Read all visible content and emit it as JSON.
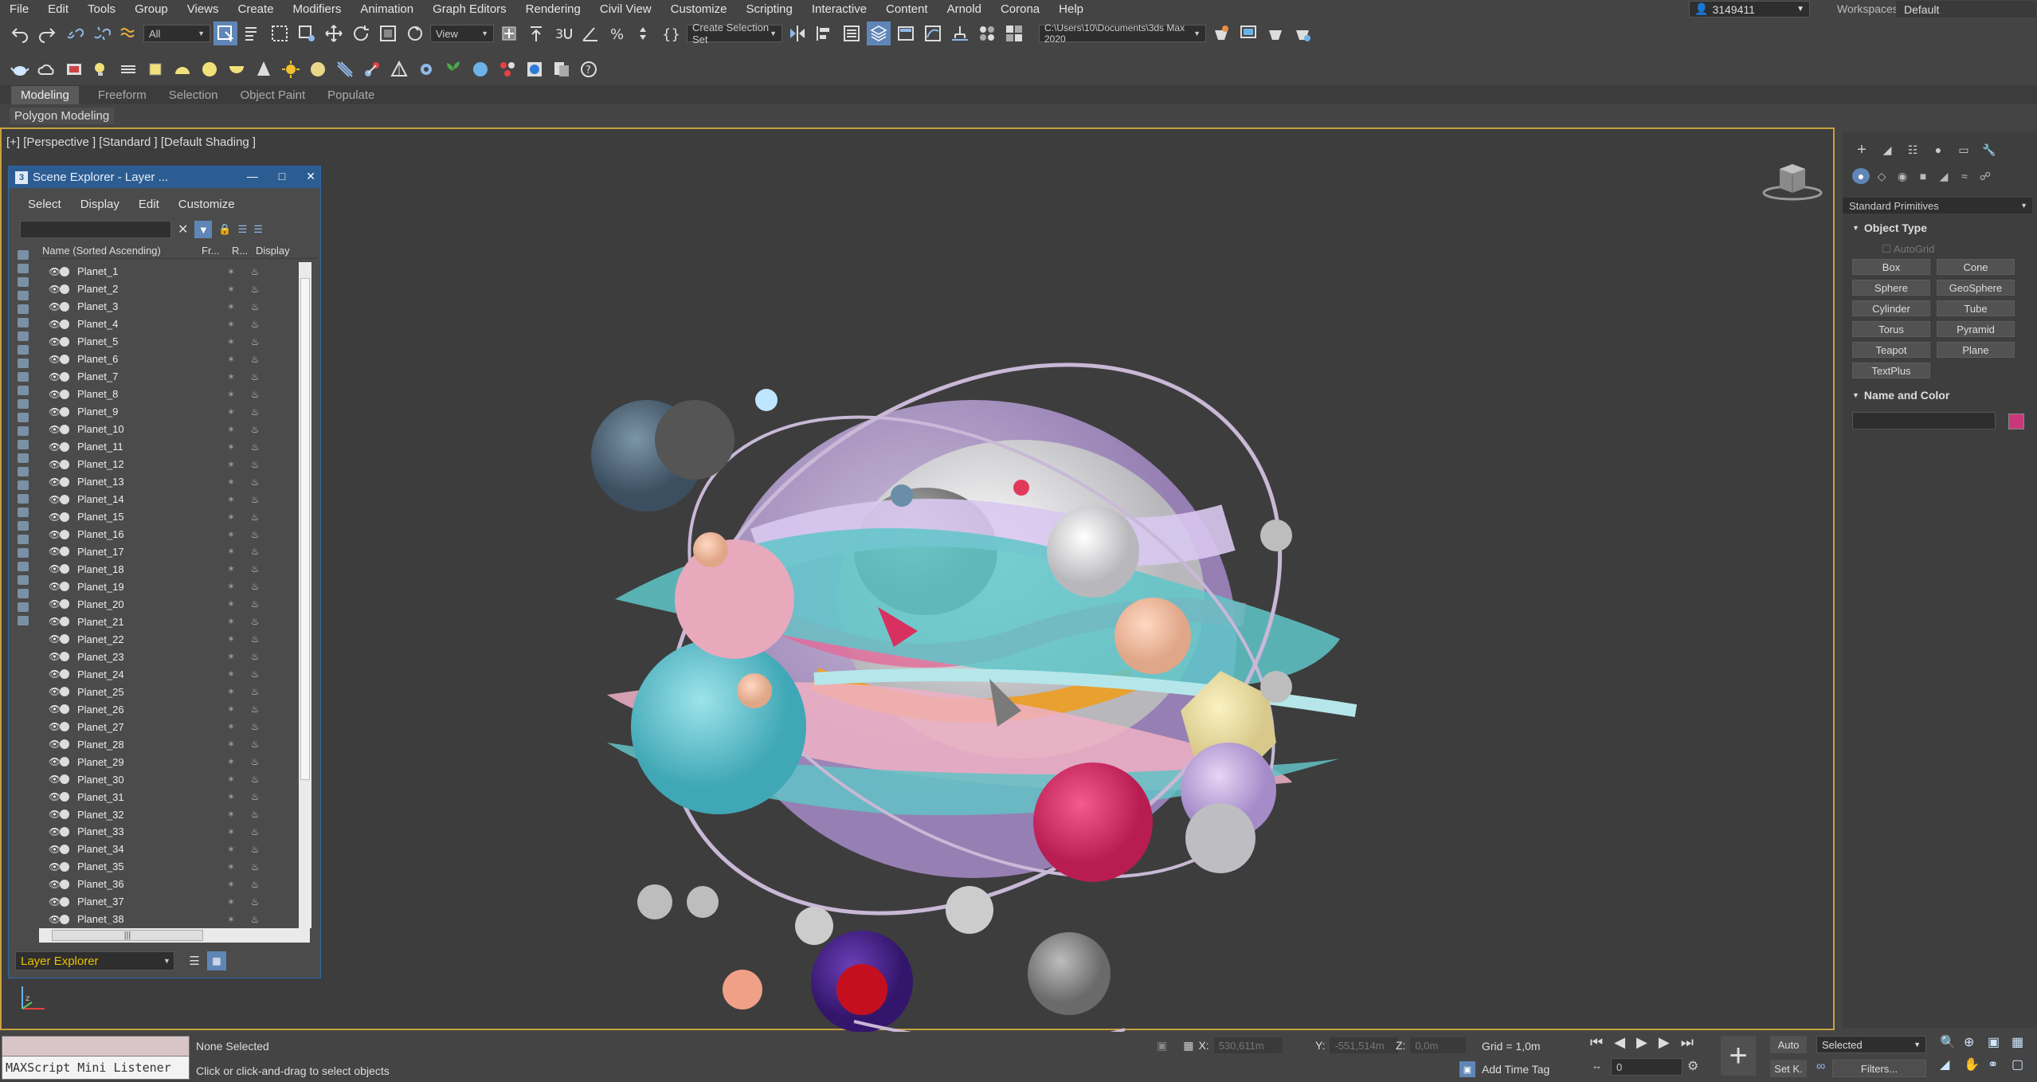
{
  "menu": [
    "File",
    "Edit",
    "Tools",
    "Group",
    "Views",
    "Create",
    "Modifiers",
    "Animation",
    "Graph Editors",
    "Rendering",
    "Civil View",
    "Customize",
    "Scripting",
    "Interactive",
    "Content",
    "Arnold",
    "Corona",
    "Help"
  ],
  "user": "3149411",
  "workspace": {
    "label": "Workspaces:",
    "value": "Default"
  },
  "toolbar": {
    "filter_value": "All",
    "coord_value": "View",
    "selection_set": "Create Selection Set",
    "project_path": "C:\\Users\\10\\Documents\\3ds Max 2020"
  },
  "ribbon": {
    "tabs": [
      "Modeling",
      "Freeform",
      "Selection",
      "Object Paint",
      "Populate"
    ],
    "active": "Modeling",
    "sub": "Polygon Modeling"
  },
  "viewport": {
    "label": "[+] [Perspective ] [Standard ] [Default Shading ]"
  },
  "scene_explorer": {
    "title": "Scene Explorer - Layer ...",
    "menus": [
      "Select",
      "Display",
      "Edit",
      "Customize"
    ],
    "columns": [
      "Name (Sorted Ascending)",
      "Fr...",
      "R...",
      "Display"
    ],
    "rows": [
      "Planet_1",
      "Planet_2",
      "Planet_3",
      "Planet_4",
      "Planet_5",
      "Planet_6",
      "Planet_7",
      "Planet_8",
      "Planet_9",
      "Planet_10",
      "Planet_11",
      "Planet_12",
      "Planet_13",
      "Planet_14",
      "Planet_15",
      "Planet_16",
      "Planet_17",
      "Planet_18",
      "Planet_19",
      "Planet_20",
      "Planet_21",
      "Planet_22",
      "Planet_23",
      "Planet_24",
      "Planet_25",
      "Planet_26",
      "Planet_27",
      "Planet_28",
      "Planet_29",
      "Planet_30",
      "Planet_31",
      "Planet_32",
      "Planet_33",
      "Planet_34",
      "Planet_35",
      "Planet_36",
      "Planet_37",
      "Planet_38"
    ],
    "explorer_type": "Layer Explorer",
    "hscroll_grip": "|||"
  },
  "command_panel": {
    "category": "Standard Primitives",
    "object_type_header": "Object Type",
    "autogrid": "AutoGrid",
    "primitives": [
      "Box",
      "Cone",
      "Sphere",
      "GeoSphere",
      "Cylinder",
      "Tube",
      "Torus",
      "Pyramid",
      "Teapot",
      "Plane",
      "TextPlus"
    ],
    "name_color_header": "Name and Color",
    "object_color": "#c8387a"
  },
  "status": {
    "maxscript": "MAXScript Mini Listener",
    "selection": "None Selected",
    "hint": "Click or click-and-drag to select objects",
    "x_label": "X:",
    "x": "530,611m",
    "y_label": "Y:",
    "y": "-551,514m",
    "z_label": "Z:",
    "z": "0,0m",
    "grid": "Grid = 1,0m",
    "add_time_tag": "Add Time Tag",
    "frame": "0",
    "auto": "Auto",
    "set_key": "Set K.",
    "key_filter": "Selected",
    "filters": "Filters..."
  },
  "colors": {
    "accent_border": "#c8a040",
    "title_bar": "#2c5d92",
    "layer_text": "#e8c000"
  }
}
